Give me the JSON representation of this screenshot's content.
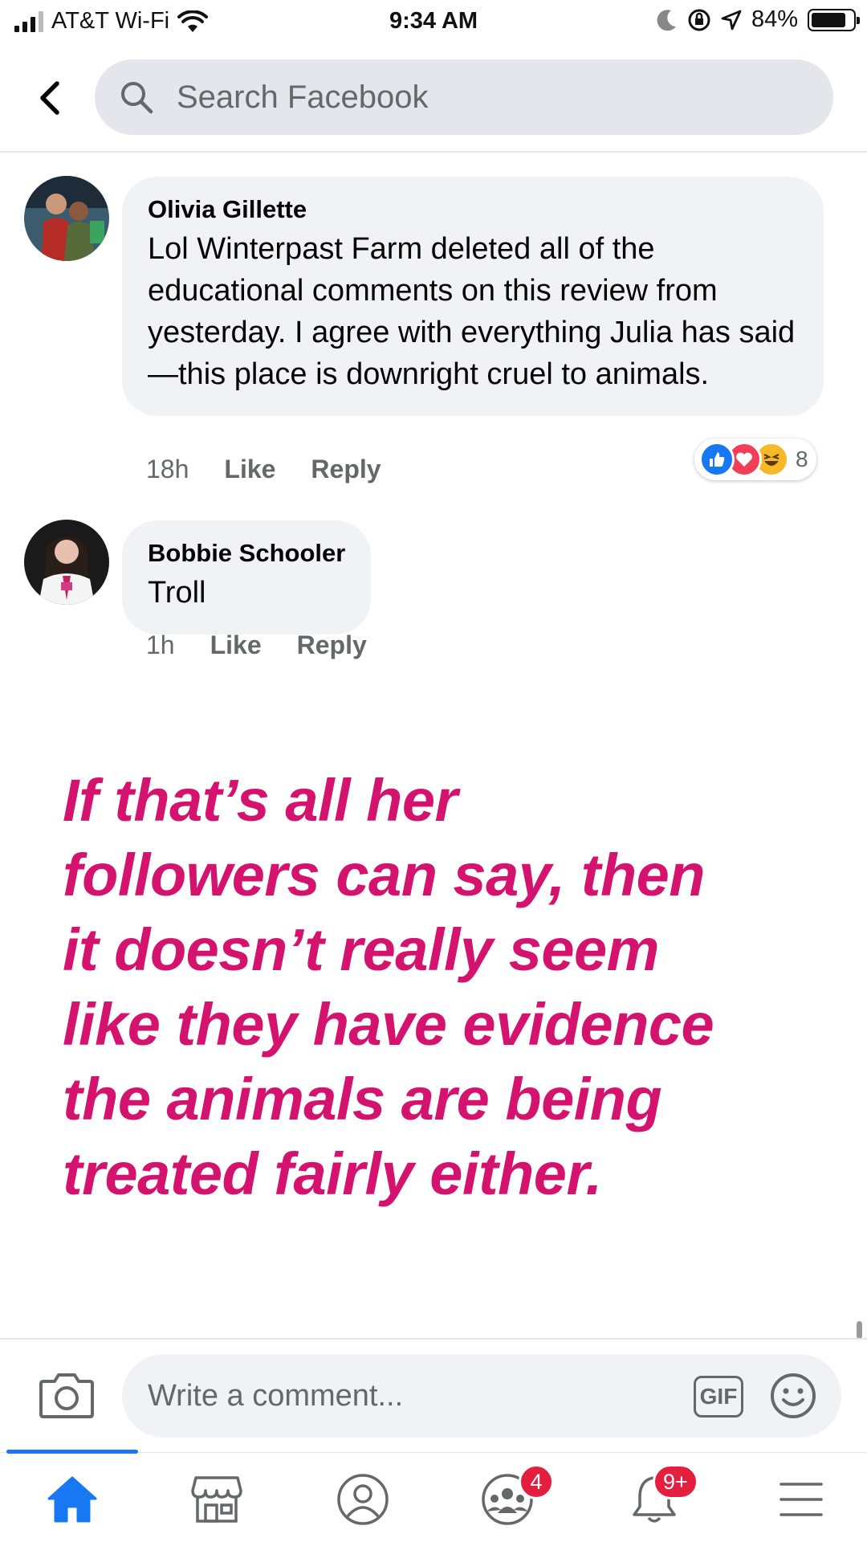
{
  "status_bar": {
    "carrier": "AT&T Wi-Fi",
    "time": "9:34 AM",
    "battery": "84%",
    "battery_level": 0.84,
    "icons": [
      "signal-icon",
      "wifi-icon",
      "moon-icon",
      "orientation-lock-icon",
      "location-icon",
      "battery-icon"
    ]
  },
  "search": {
    "placeholder": "Search Facebook"
  },
  "comments": [
    {
      "author": "Olivia Gillette",
      "text": "Lol Winterpast Farm deleted all of the educational comments on this review from yesterday. I agree with everything Julia has said—this place is downright cruel to animals.",
      "time": "18h",
      "like_label": "Like",
      "reply_label": "Reply",
      "reactions": [
        "like",
        "love",
        "haha"
      ],
      "reaction_count": "8"
    },
    {
      "author": "Bobbie Schooler",
      "text": "Troll",
      "time": "1h",
      "like_label": "Like",
      "reply_label": "Reply"
    }
  ],
  "overlay": {
    "lines": [
      "If that’s all her",
      "followers can say, then",
      "it doesn’t really seem",
      "like they have evidence",
      "the animals are being",
      "treated fairly either."
    ],
    "color": "#d4136f"
  },
  "composer": {
    "placeholder": "Write a comment...",
    "gif_label": "GIF"
  },
  "bottom_nav": {
    "items": [
      {
        "name": "home",
        "icon": "home-icon",
        "active": true
      },
      {
        "name": "marketplace",
        "icon": "marketplace-icon"
      },
      {
        "name": "profile",
        "icon": "profile-icon"
      },
      {
        "name": "groups",
        "icon": "groups-icon",
        "badge": "4"
      },
      {
        "name": "notifications",
        "icon": "bell-icon",
        "badge": "9+"
      },
      {
        "name": "menu",
        "icon": "menu-icon"
      }
    ]
  },
  "colors": {
    "accent": "#1877f2",
    "bubble": "#f0f2f5",
    "badge": "#e41e3f",
    "overlay_text": "#d4136f"
  }
}
